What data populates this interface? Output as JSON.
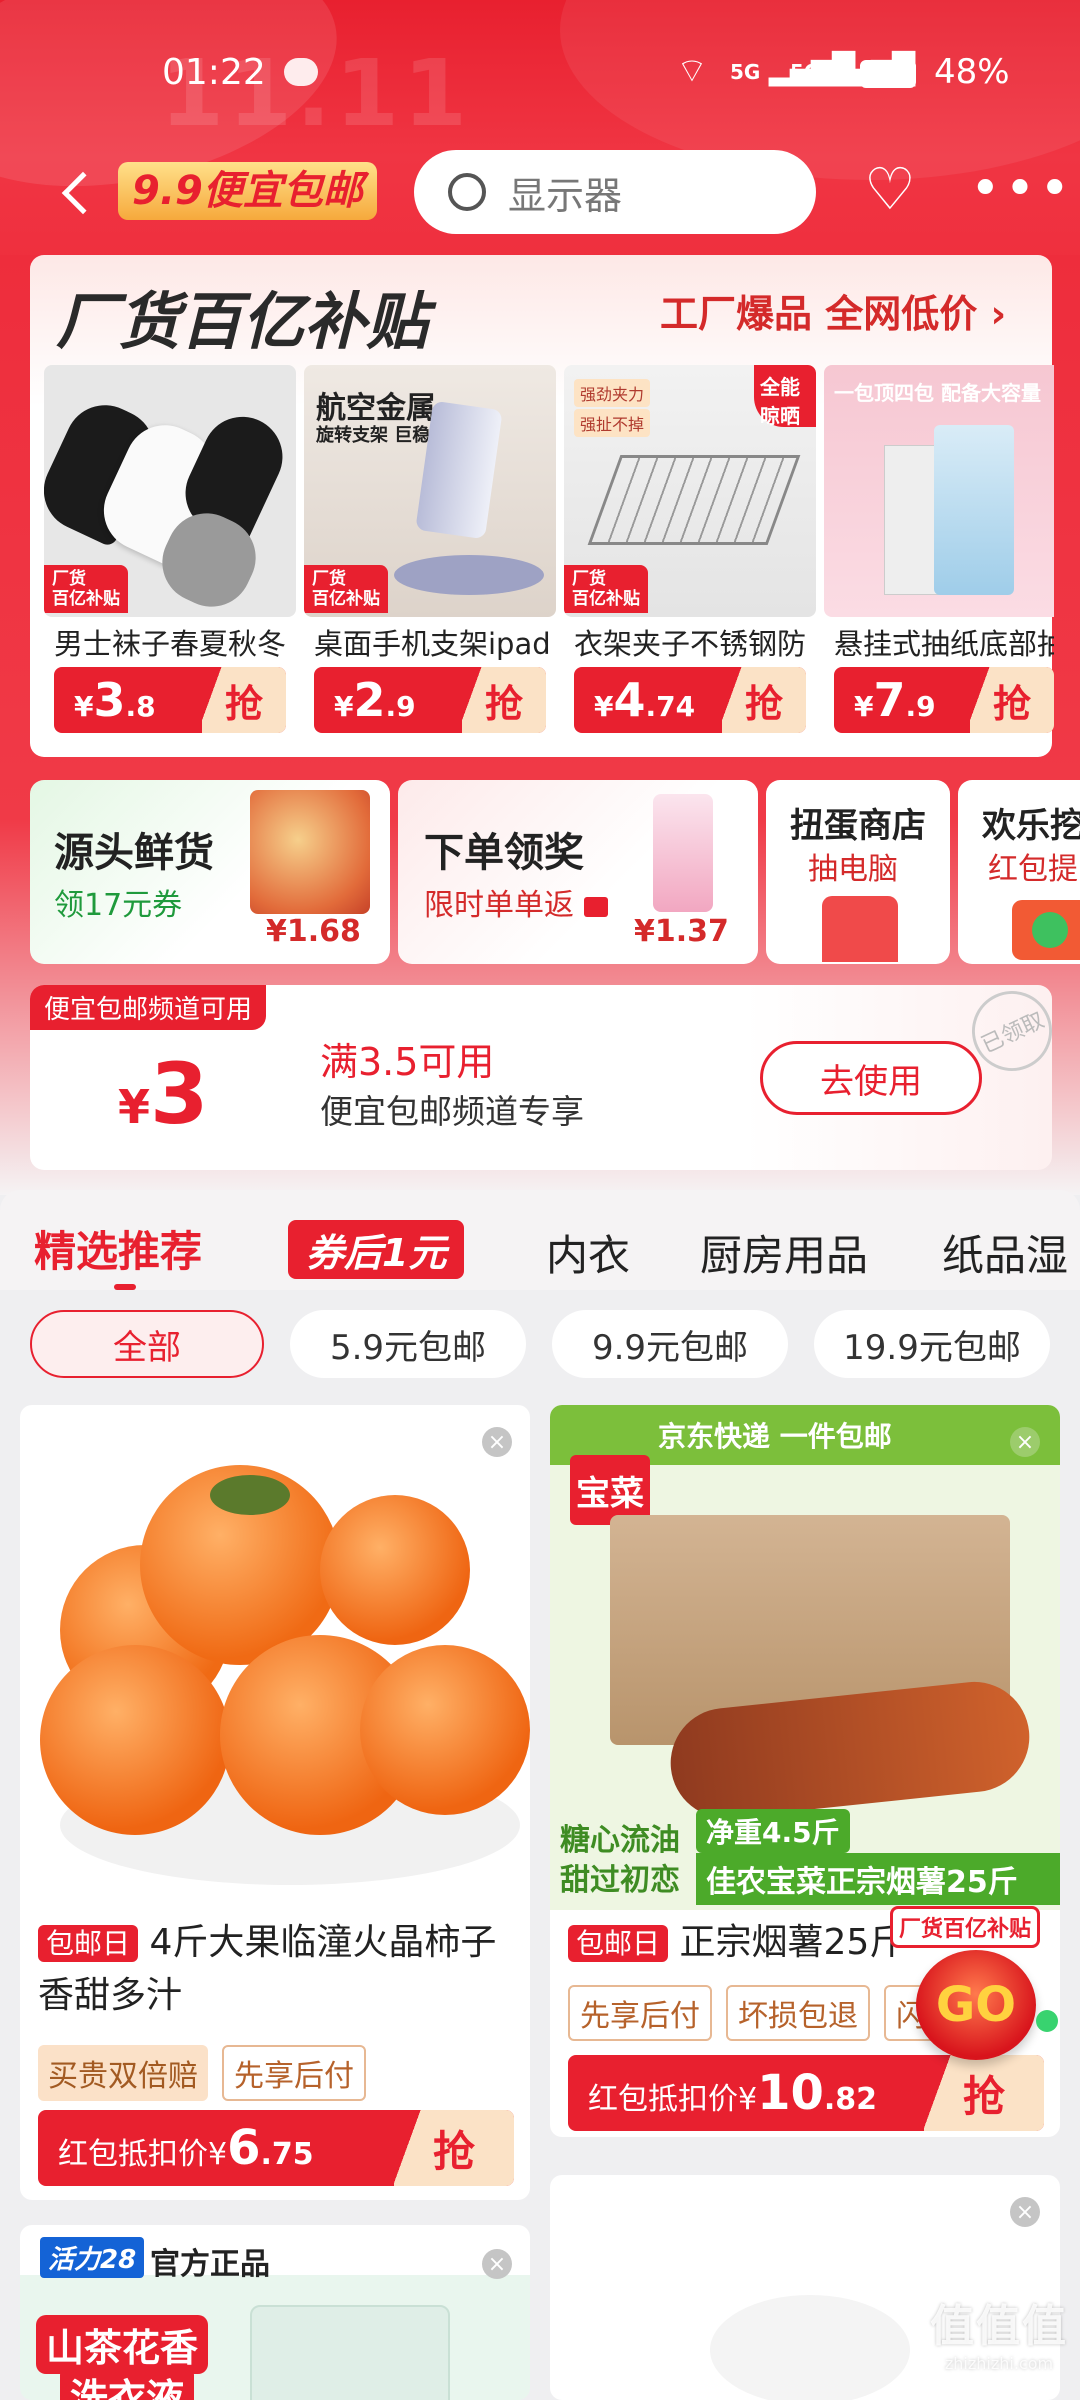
{
  "status_bar": {
    "time": "01:22",
    "net1": "5G",
    "net2": "5G",
    "battery": "48%"
  },
  "header": {
    "logo_text": "9.9便宜包邮",
    "search_placeholder": "显示器",
    "bg_watermark": "11.11"
  },
  "subsidy": {
    "title": "厂货百亿补贴",
    "right_text": "工厂爆品 全网低价",
    "badge": "厂货\n百亿补贴",
    "products": [
      {
        "name": "男士袜子春夏秋冬",
        "int": "3",
        "dec": ".8"
      },
      {
        "name": "桌面手机支架ipad",
        "int": "2",
        "dec": ".9",
        "img_text1": "航空金属",
        "img_text2": "旋转支架 巨稳!"
      },
      {
        "name": "衣架夹子不锈钢防",
        "int": "4",
        "dec": ".74",
        "img_corner": "全能\n晾晒",
        "img_text1": "强劲夹力",
        "img_text2": "强扯不掉"
      },
      {
        "name": "悬挂式抽纸底部抽",
        "int": "7",
        "dec": ".9",
        "img_text1": "一包顶四包 配备大容量"
      }
    ],
    "currency": "¥",
    "grab": "抢"
  },
  "channels": [
    {
      "title": "源头鲜货",
      "sub": "领17元券",
      "price": "¥1.68"
    },
    {
      "title": "下单领奖",
      "sub": "限时单单返",
      "price": "¥1.37"
    },
    {
      "title": "扭蛋商店",
      "sub": "抽电脑"
    },
    {
      "title": "欢乐挖",
      "sub": "红包提"
    }
  ],
  "coupon": {
    "tag": "便宜包邮频道可用",
    "amount": "3",
    "currency": "¥",
    "cond": "满3.5可用",
    "desc": "便宜包邮频道专享",
    "button": "去使用",
    "stamp": "已领取"
  },
  "tabs": [
    "精选推荐",
    "券后1元",
    "内衣",
    "厨房用品",
    "纸品湿"
  ],
  "chips": [
    "全部",
    "5.9元包邮",
    "9.9元包邮",
    "19.9元包邮"
  ],
  "feed": [
    {
      "badge": "包邮日",
      "title": "4斤大果临潼火晶柿子香甜多汁",
      "tags": [
        "买贵双倍赔",
        "先享后付"
      ],
      "price_label": "红包抵扣价¥",
      "int": "6",
      "dec": ".75",
      "grab": "抢"
    },
    {
      "badge": "包邮日",
      "title": "正宗烟薯25斤",
      "tags": [
        "先享后付",
        "坏损包退",
        "闪"
      ],
      "price_label": "红包抵扣价¥",
      "int": "10",
      "dec": ".82",
      "grab": "抢",
      "img_top": "京东快递 一件包邮",
      "img_brand": "宝菜",
      "img_weight": "净重4.5斤",
      "img_slogan1": "糖心流油",
      "img_slogan2": "甜过初恋",
      "img_bottom": "佳农宝菜正宗烟薯25斤"
    },
    {
      "brand_badge": "活力28",
      "label": "官方正品",
      "img_text1": "山茶花香",
      "img_text2": "洗衣液"
    }
  ],
  "float": {
    "title": "厂货百亿补贴",
    "go": "GO"
  },
  "watermark": {
    "big": "值值值",
    "small": "zhizhizhi.com"
  }
}
